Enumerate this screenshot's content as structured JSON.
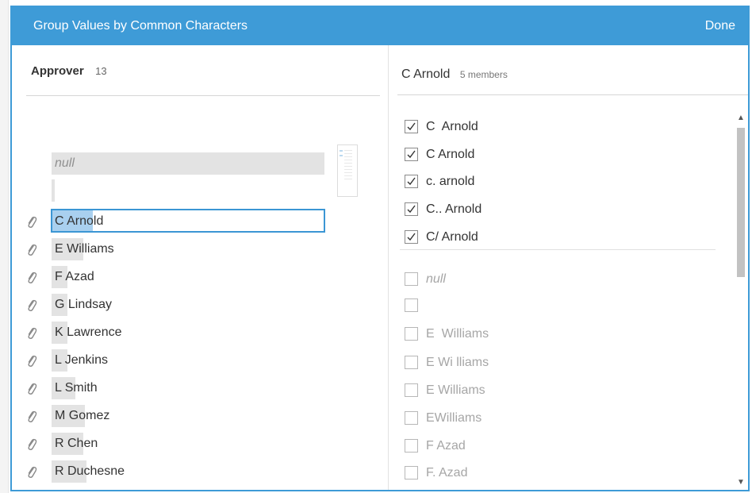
{
  "dialog": {
    "title": "Group Values by Common Characters",
    "done_label": "Done"
  },
  "left": {
    "field_name": "Approver",
    "field_count": "13",
    "values": [
      {
        "label": "null",
        "kind": "null"
      },
      {
        "label": "",
        "kind": "blank"
      },
      {
        "label": "C Arnold",
        "kind": "group",
        "selected": true
      },
      {
        "label": "E Williams",
        "kind": "group"
      },
      {
        "label": "F Azad",
        "kind": "group"
      },
      {
        "label": "G Lindsay",
        "kind": "group"
      },
      {
        "label": "K Lawrence",
        "kind": "group"
      },
      {
        "label": "L Jenkins",
        "kind": "group"
      },
      {
        "label": "L Smith",
        "kind": "group"
      },
      {
        "label": "M Gomez",
        "kind": "group"
      },
      {
        "label": "R Chen",
        "kind": "group"
      },
      {
        "label": "R Duchesne",
        "kind": "group"
      }
    ]
  },
  "right": {
    "group_name": "C Arnold",
    "member_count": "5 members",
    "members": [
      {
        "label": "C  Arnold",
        "checked": true
      },
      {
        "label": "C Arnold",
        "checked": true
      },
      {
        "label": "c. arnold",
        "checked": true
      },
      {
        "label": "C.. Arnold",
        "checked": true
      },
      {
        "label": "C/ Arnold",
        "checked": true
      }
    ],
    "others": [
      {
        "label": "null",
        "checked": false,
        "kind": "null"
      },
      {
        "label": "",
        "checked": false
      },
      {
        "label": "E  Williams",
        "checked": false
      },
      {
        "label": "E Wi lliams",
        "checked": false
      },
      {
        "label": "E Williams",
        "checked": false
      },
      {
        "label": "EWilliams",
        "checked": false
      },
      {
        "label": "F Azad",
        "checked": false
      },
      {
        "label": "F. Azad",
        "checked": false
      }
    ]
  },
  "colors": {
    "accent": "#3e9bd7",
    "highlight": "#a9d0ef",
    "pill": "#e3e3e3"
  },
  "icons": {
    "link": "paperclip-icon",
    "check": "checkmark-icon",
    "scroll_up": "scroll-up-arrow-icon",
    "scroll_down": "scroll-down-arrow-icon"
  }
}
